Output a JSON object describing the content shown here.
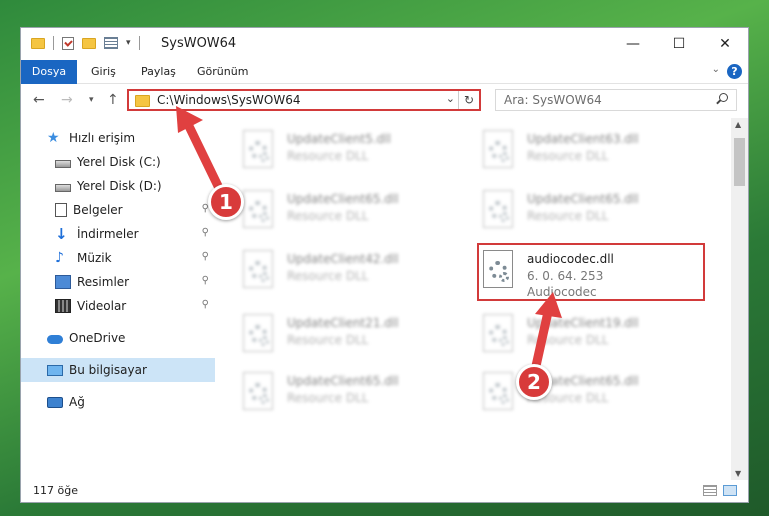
{
  "window": {
    "title": "SysWOW64",
    "controls": {
      "minimize": "—",
      "maximize": "☐",
      "close": "✕"
    }
  },
  "ribbon": {
    "tabs": [
      "Dosya",
      "Giriş",
      "Paylaş",
      "Görünüm"
    ],
    "help": "?"
  },
  "navigation": {
    "address": "C:\\Windows\\SysWOW64",
    "search_placeholder": "Ara: SysWOW64"
  },
  "sidebar": {
    "items": [
      {
        "label": "Hızlı erişim",
        "icon": "star-icon"
      },
      {
        "label": "Yerel Disk (C:)",
        "icon": "disk-icon"
      },
      {
        "label": "Yerel Disk (D:)",
        "icon": "disk-icon"
      },
      {
        "label": "Belgeler",
        "icon": "documents-icon"
      },
      {
        "label": "İndirmeler",
        "icon": "download-icon"
      },
      {
        "label": "Müzik",
        "icon": "music-icon"
      },
      {
        "label": "Resimler",
        "icon": "pictures-icon"
      },
      {
        "label": "Videolar",
        "icon": "video-icon"
      },
      {
        "label": "OneDrive",
        "icon": "cloud-icon"
      },
      {
        "label": "Bu bilgisayar",
        "icon": "computer-icon"
      },
      {
        "label": "Ağ",
        "icon": "network-icon"
      }
    ]
  },
  "files": [
    {
      "name": "UpdateClient5.dll",
      "desc": "Resource DLL"
    },
    {
      "name": "UpdateClient63.dll",
      "desc": "Resource DLL"
    },
    {
      "name": "UpdateClient65.dll",
      "desc": "Resource DLL"
    },
    {
      "name": "UpdateClient65.dll",
      "desc": "Resource DLL"
    },
    {
      "name": "UpdateClient42.dll",
      "desc": "Resource DLL"
    },
    {
      "name": "audiocodec.dll",
      "version": "6. 0. 64. 253",
      "desc": "Audiocodec"
    },
    {
      "name": "UpdateClient21.dll",
      "desc": "Resource DLL"
    },
    {
      "name": "UpdateClient19.dll",
      "desc": "Resource DLL"
    },
    {
      "name": "UpdateClient65.dll",
      "desc": "Resource DLL"
    },
    {
      "name": "UpdateClient65.dll",
      "desc": "Resource DLL"
    }
  ],
  "status": {
    "item_count": "117 öğe"
  },
  "annotations": {
    "badge1": "1",
    "badge2": "2",
    "accent": "#d83b3b"
  }
}
